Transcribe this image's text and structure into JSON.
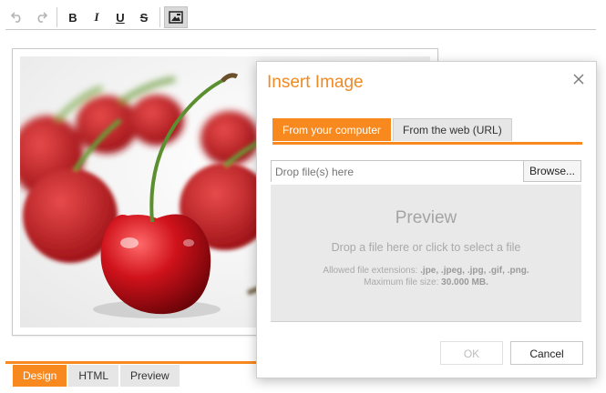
{
  "toolbar": {
    "undo_icon": "undo-icon",
    "redo_icon": "redo-icon",
    "bold_label": "B",
    "italic_label": "I",
    "underline_label": "U",
    "strike_label": "S",
    "image_icon": "image-icon"
  },
  "editor": {
    "image_subject": "cherries-photo"
  },
  "mode_tabs": [
    {
      "label": "Design",
      "active": true
    },
    {
      "label": "HTML",
      "active": false
    },
    {
      "label": "Preview",
      "active": false
    }
  ],
  "dialog": {
    "title": "Insert Image",
    "tabs": [
      {
        "label": "From your computer",
        "active": true
      },
      {
        "label": "From the web (URL)",
        "active": false
      }
    ],
    "file_input_placeholder": "Drop file(s) here",
    "browse_label": "Browse...",
    "preview_title": "Preview",
    "preview_hint": "Drop a file here or click to select a file",
    "allowed_label": "Allowed file extensions:",
    "allowed_value": ".jpe, .jpeg, .jpg, .gif, .png.",
    "max_size_label": "Maximum file size:",
    "max_size_value": "30.000 MB.",
    "ok_label": "OK",
    "cancel_label": "Cancel"
  },
  "colors": {
    "accent": "#f7891f",
    "title": "#f08a24"
  }
}
